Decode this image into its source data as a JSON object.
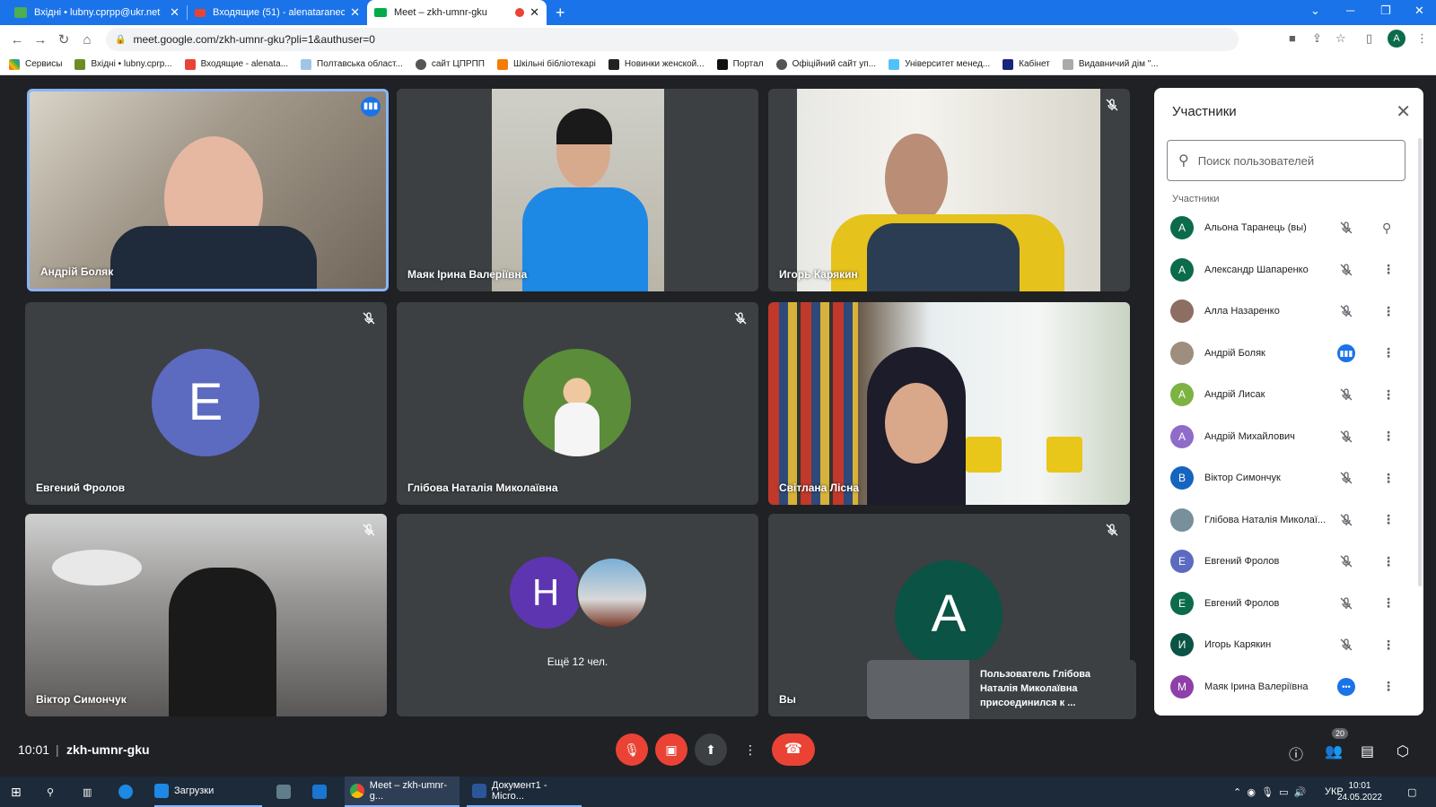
{
  "browser": {
    "tabs": [
      {
        "title": "Вхідні • lubny.cprpp@ukr.net",
        "icon_color": "#4caf50"
      },
      {
        "title": "Входящие (51) - alenataranec20",
        "icon_color": "#ea4335"
      },
      {
        "title": "Meet – zkh-umnr-gku",
        "icon_color": "#00ac47",
        "recording": true
      }
    ],
    "url": "meet.google.com/zkh-umnr-gku?pli=1&authuser=0",
    "profile_letter": "A",
    "bookmarks": [
      "Сервисы",
      "Вхідні • lubny.cprp...",
      "Входящие - alenata...",
      "Полтавська област...",
      "сайт ЦПРПП",
      "Шкільні бібліотекарі",
      "Новинки женской...",
      "Портал",
      "Офіційний сайт уп...",
      "Університет менед...",
      "Кабінет",
      "Видавничий дім \"..."
    ]
  },
  "tiles": [
    {
      "name": "Андрій Боляк",
      "type": "video",
      "speaking": true
    },
    {
      "name": "Маяк Ірина Валеріївна",
      "type": "video"
    },
    {
      "name": "Игорь Карякин",
      "type": "video",
      "muted": true
    },
    {
      "name": "Евгений Фролов",
      "type": "avatar",
      "letter": "E",
      "color": "#5c6bc0",
      "muted": true
    },
    {
      "name": "Глібова Наталія Миколаївна",
      "type": "photo",
      "muted": true
    },
    {
      "name": "Світлана Лісна",
      "type": "video"
    },
    {
      "name": "Віктор Симончук",
      "type": "video",
      "muted": true
    },
    {
      "name": "",
      "type": "more",
      "letter": "Н",
      "label": "Ещё 12 чел."
    },
    {
      "name": "Вы",
      "type": "avatar",
      "letter": "A",
      "color": "#0b5345",
      "muted": true
    }
  ],
  "panel": {
    "title": "Участники",
    "search_placeholder": "Поиск пользователей",
    "section": "Участники",
    "participants": [
      {
        "name": "Альона Таранець (вы)",
        "letter": "A",
        "color": "#0b6b4a",
        "status": "muted",
        "action": "pin"
      },
      {
        "name": "Александр Шапаренко",
        "letter": "A",
        "color": "#0b6b4a",
        "status": "muted",
        "action": "more"
      },
      {
        "name": "Алла Назаренко",
        "letter": "",
        "color": "#8d6e63",
        "status": "muted",
        "action": "more"
      },
      {
        "name": "Андрій Боляк",
        "letter": "",
        "color": "#9e8e7e",
        "status": "speaking",
        "action": "more"
      },
      {
        "name": "Андрій Лисак",
        "letter": "A",
        "color": "#7cb342",
        "status": "muted",
        "action": "more"
      },
      {
        "name": "Андрій Михайлович",
        "letter": "A",
        "color": "#8e6cc8",
        "status": "muted",
        "action": "more"
      },
      {
        "name": "Віктор Симончук",
        "letter": "B",
        "color": "#1565c0",
        "status": "muted",
        "action": "more"
      },
      {
        "name": "Глібова Наталія Миколаї...",
        "letter": "",
        "color": "#78909c",
        "status": "muted",
        "action": "more"
      },
      {
        "name": "Евгений Фролов",
        "letter": "E",
        "color": "#5c6bc0",
        "status": "muted",
        "action": "more"
      },
      {
        "name": "Евгений Фролов",
        "letter": "E",
        "color": "#0b6b4a",
        "status": "muted",
        "action": "more"
      },
      {
        "name": "Игорь Карякин",
        "letter": "И",
        "color": "#0b5345",
        "status": "muted",
        "action": "more"
      },
      {
        "name": "Маяк Ірина Валеріївна",
        "letter": "M",
        "color": "#8e3fa8",
        "status": "dots",
        "action": "more"
      }
    ]
  },
  "toast": {
    "text": "Пользователь Глібова Наталія Миколаївна присоединился к ..."
  },
  "bottom": {
    "time": "10:01",
    "code": "zkh-umnr-gku",
    "participant_count": "20"
  },
  "taskbar": {
    "items": [
      "Загрузки",
      "Meet – zkh-umnr-g...",
      "Документ1 - Micro..."
    ],
    "lang": "УКР",
    "time": "10:01",
    "date": "24.05.2022"
  },
  "colors": {
    "accent": "#1a73e8",
    "end_call": "#ea4335",
    "bg": "#202124"
  }
}
